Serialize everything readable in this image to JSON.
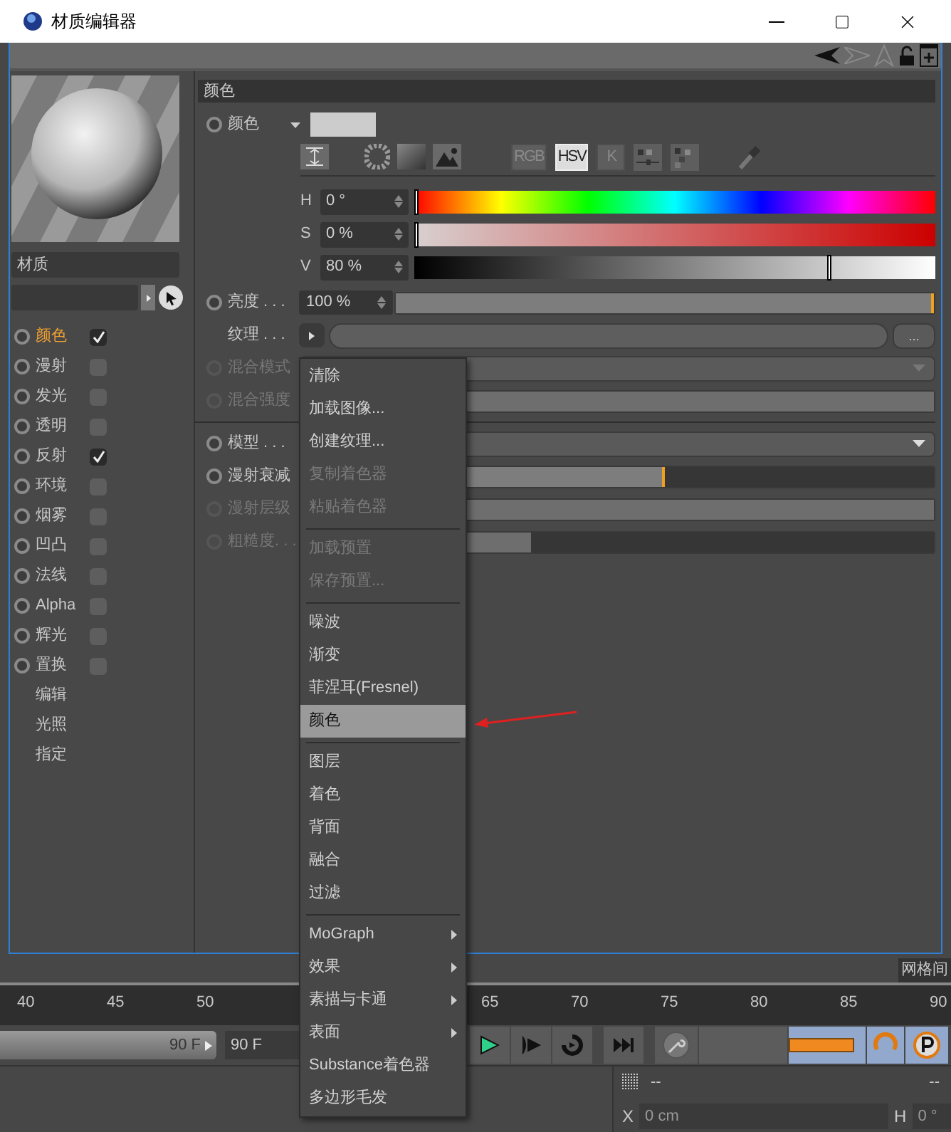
{
  "window": {
    "title": "材质编辑器"
  },
  "material": {
    "name": "材质"
  },
  "channels": [
    {
      "kind": "channel",
      "label": "颜色",
      "selected": true,
      "checked": true
    },
    {
      "kind": "channel",
      "label": "漫射",
      "selected": false,
      "checked": false
    },
    {
      "kind": "channel",
      "label": "发光",
      "selected": false,
      "checked": false
    },
    {
      "kind": "channel",
      "label": "透明",
      "selected": false,
      "checked": false
    },
    {
      "kind": "channel",
      "label": "反射",
      "selected": false,
      "checked": true
    },
    {
      "kind": "channel",
      "label": "环境",
      "selected": false,
      "checked": false
    },
    {
      "kind": "channel",
      "label": "烟雾",
      "selected": false,
      "checked": false
    },
    {
      "kind": "channel",
      "label": "凹凸",
      "selected": false,
      "checked": false
    },
    {
      "kind": "channel",
      "label": "法线",
      "selected": false,
      "checked": false
    },
    {
      "kind": "channel",
      "label": "Alpha",
      "selected": false,
      "checked": false
    },
    {
      "kind": "channel",
      "label": "辉光",
      "selected": false,
      "checked": false
    },
    {
      "kind": "channel",
      "label": "置换",
      "selected": false,
      "checked": false
    },
    {
      "kind": "page",
      "label": "编辑",
      "selected": false
    },
    {
      "kind": "page",
      "label": "光照",
      "selected": false
    },
    {
      "kind": "page",
      "label": "指定",
      "selected": false
    }
  ],
  "section_title": "颜色",
  "color": {
    "label": "颜色",
    "swatch": {
      "color": "#cccccc"
    },
    "modes": [
      {
        "label": "RGB",
        "selected": false
      },
      {
        "label": "HSV",
        "selected": true
      },
      {
        "label": "K",
        "selected": false
      }
    ],
    "components": [
      {
        "kind": "hue",
        "label": "H",
        "value": "0 °",
        "level": 0
      },
      {
        "kind": "saturation",
        "label": "S",
        "value": "0 %",
        "level": 0
      },
      {
        "kind": "value",
        "label": "V",
        "value": "80 %",
        "level": 0.8
      }
    ]
  },
  "settings": [
    {
      "kind": "slider",
      "label": "亮度 . . .",
      "radio": true,
      "disabled": false,
      "value": "100 %",
      "level": 1
    },
    {
      "kind": "texture",
      "label": "纹理 . . .",
      "radio": false,
      "disabled": false,
      "more_button": "..."
    },
    {
      "kind": "dropdown",
      "label": "混合模式",
      "radio": true,
      "disabled": true
    },
    {
      "kind": "slider",
      "label": "混合强度",
      "radio": true,
      "disabled": true,
      "level": 1
    },
    {
      "kind": "separator"
    },
    {
      "kind": "dropdown",
      "label": "模型 . . .",
      "radio": true,
      "disabled": false
    },
    {
      "kind": "slider",
      "label": "漫射衰减",
      "radio": true,
      "disabled": false,
      "level": 0.5
    },
    {
      "kind": "slider",
      "label": "漫射层级",
      "radio": true,
      "disabled": true,
      "level": 1
    },
    {
      "kind": "slider",
      "label": "粗糙度. . .",
      "radio": true,
      "disabled": true,
      "level": 0.25
    }
  ],
  "menu": [
    {
      "kind": "item",
      "label": "清除",
      "disabled": false,
      "selected": false,
      "submenu": false
    },
    {
      "kind": "item",
      "label": "加载图像...",
      "disabled": false,
      "selected": false,
      "submenu": false
    },
    {
      "kind": "item",
      "label": "创建纹理...",
      "disabled": false,
      "selected": false,
      "submenu": false
    },
    {
      "kind": "item",
      "label": "复制着色器",
      "disabled": true,
      "selected": false,
      "submenu": false
    },
    {
      "kind": "item",
      "label": "粘贴着色器",
      "disabled": true,
      "selected": false,
      "submenu": false
    },
    {
      "kind": "separator"
    },
    {
      "kind": "item",
      "label": "加载预置",
      "disabled": true,
      "selected": false,
      "submenu": false
    },
    {
      "kind": "item",
      "label": "保存预置...",
      "disabled": true,
      "selected": false,
      "submenu": false
    },
    {
      "kind": "separator"
    },
    {
      "kind": "item",
      "label": "噪波",
      "disabled": false,
      "selected": false,
      "submenu": false
    },
    {
      "kind": "item",
      "label": "渐变",
      "disabled": false,
      "selected": false,
      "submenu": false
    },
    {
      "kind": "item",
      "label": "菲涅耳(Fresnel)",
      "disabled": false,
      "selected": false,
      "submenu": false
    },
    {
      "kind": "item",
      "label": "颜色",
      "disabled": false,
      "selected": true,
      "submenu": false
    },
    {
      "kind": "separator"
    },
    {
      "kind": "item",
      "label": "图层",
      "disabled": false,
      "selected": false,
      "submenu": false
    },
    {
      "kind": "item",
      "label": "着色",
      "disabled": false,
      "selected": false,
      "submenu": false
    },
    {
      "kind": "item",
      "label": "背面",
      "disabled": false,
      "selected": false,
      "submenu": false
    },
    {
      "kind": "item",
      "label": "融合",
      "disabled": false,
      "selected": false,
      "submenu": false
    },
    {
      "kind": "item",
      "label": "过滤",
      "disabled": false,
      "selected": false,
      "submenu": false
    },
    {
      "kind": "separator"
    },
    {
      "kind": "item",
      "label": "MoGraph",
      "disabled": false,
      "selected": false,
      "submenu": true
    },
    {
      "kind": "item",
      "label": "效果",
      "disabled": false,
      "selected": false,
      "submenu": true
    },
    {
      "kind": "item",
      "label": "素描与卡通",
      "disabled": false,
      "selected": false,
      "submenu": true
    },
    {
      "kind": "item",
      "label": "表面",
      "disabled": false,
      "selected": false,
      "submenu": true
    },
    {
      "kind": "item",
      "label": "Substance着色器",
      "disabled": false,
      "selected": false,
      "submenu": false
    },
    {
      "kind": "item",
      "label": "多边形毛发",
      "disabled": false,
      "selected": false,
      "submenu": false
    }
  ],
  "viewport_tooltip": "网格间",
  "timeline": {
    "ticks_before_menu": [
      "40",
      "45",
      "50"
    ],
    "ticks_after_menu": [
      "65",
      "70",
      "75",
      "80",
      "85",
      "90"
    ],
    "end_slider_value": "90 F",
    "range": {
      "level": 1
    },
    "end_field_value": "90 F"
  },
  "coordinates": {
    "header_left": "--",
    "header_right": "--",
    "x_label": "X",
    "x_value": "0 cm",
    "h_label": "H",
    "h_value": "0 °"
  }
}
